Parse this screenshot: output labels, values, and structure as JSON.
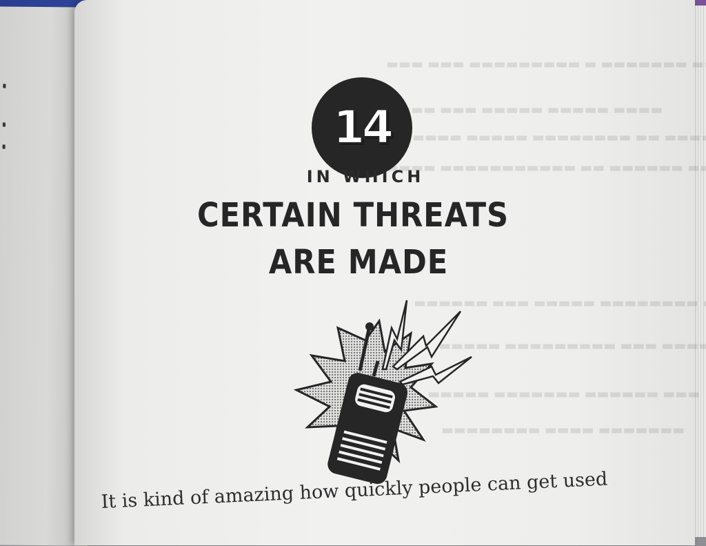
{
  "chapter": {
    "number": "14",
    "kicker": "IN WHICH",
    "title_line_1": "CERTAIN THREATS",
    "title_line_2": "ARE MADE"
  },
  "body": {
    "first_line": "It is kind of amazing how quickly people can get used"
  },
  "illustration": {
    "icon": "walkie-talkie-icon",
    "burst_icon": "starburst-icon",
    "signal_icon": "lightning-bolt-icon"
  },
  "colors": {
    "ink": "#262626",
    "paper": "#f0f0ee"
  }
}
